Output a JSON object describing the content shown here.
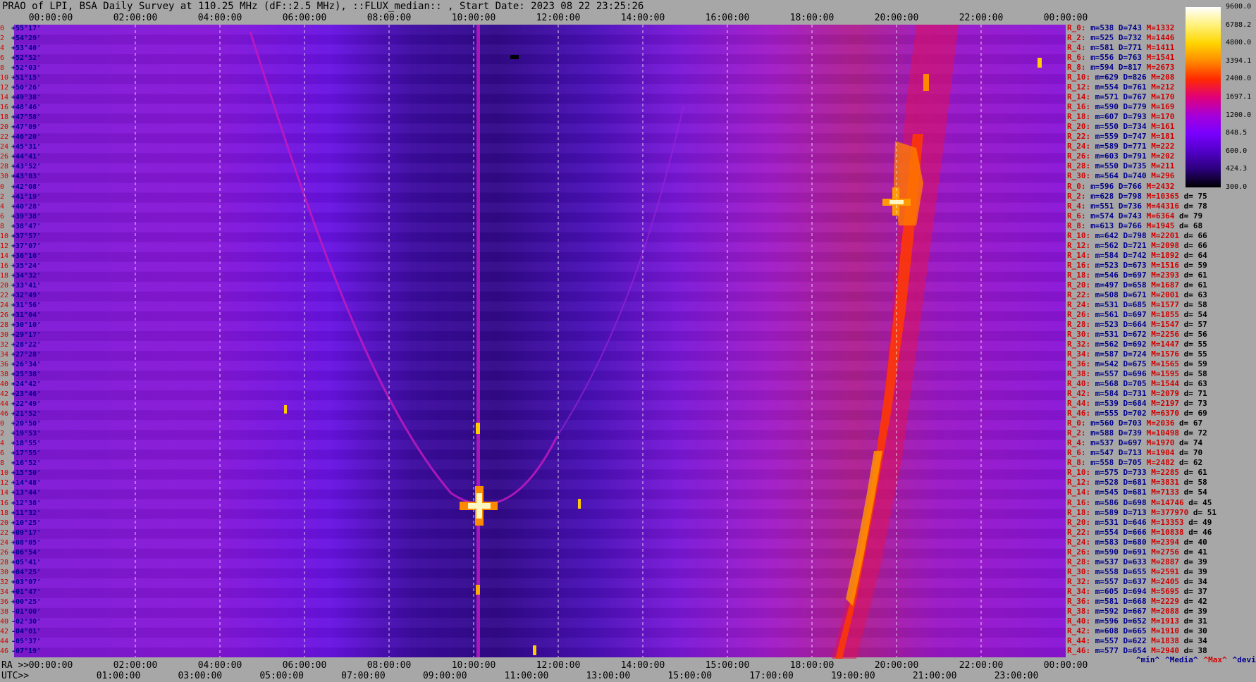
{
  "title": "PRAO of LPI, BSA Daily Survey at 110.25 MHz (dF::2.5 MHz), ::FLUX_median:: , Start Date: 2023 08 22 23:25:26",
  "chart_data": {
    "type": "heatmap",
    "title": "PRAO of LPI, BSA Daily Survey at 110.25 MHz (dF::2.5 MHz), ::FLUX_median:: , Start Date: 2023 08 22 23:25:26",
    "x_top_ticks": [
      "00:00:00",
      "02:00:00",
      "04:00:00",
      "06:00:00",
      "08:00:00",
      "10:00:00",
      "12:00:00",
      "14:00:00",
      "16:00:00",
      "18:00:00",
      "20:00:00",
      "22:00:00",
      "00:00:00"
    ],
    "x_bottom_ra_label": "RA >>",
    "x_bottom_ra_ticks": [
      "00:00:00",
      "02:00:00",
      "04:00:00",
      "06:00:00",
      "08:00:00",
      "10:00:00",
      "12:00:00",
      "14:00:00",
      "15:00:00",
      "18:00:00",
      "20:00:00",
      "22:00:00",
      "00:00:00"
    ],
    "x_bottom_utc_label": "UTC>>",
    "x_bottom_utc_ticks": [
      "01:00:00",
      "03:00:00",
      "05:00:00",
      "07:00:00",
      "09:00:00",
      "11:00:00",
      "13:00:00",
      "15:00:00",
      "17:00:00",
      "19:00:00",
      "21:00:00",
      "23:00:00"
    ],
    "y_rows": [
      {
        "n": "0",
        "dec": "+55°17'"
      },
      {
        "n": "2",
        "dec": "+54°29'"
      },
      {
        "n": "4",
        "dec": "+53°40'"
      },
      {
        "n": "6",
        "dec": "+52°52'"
      },
      {
        "n": "8",
        "dec": "+52°03'"
      },
      {
        "n": "10",
        "dec": "+51°15'"
      },
      {
        "n": "12",
        "dec": "+50°26'"
      },
      {
        "n": "14",
        "dec": "+49°38'"
      },
      {
        "n": "16",
        "dec": "+48°46'"
      },
      {
        "n": "18",
        "dec": "+47°58'"
      },
      {
        "n": "20",
        "dec": "+47°09'"
      },
      {
        "n": "22",
        "dec": "+46°20'"
      },
      {
        "n": "24",
        "dec": "+45°31'"
      },
      {
        "n": "26",
        "dec": "+44°41'"
      },
      {
        "n": "28",
        "dec": "+43°52'"
      },
      {
        "n": "30",
        "dec": "+43°03'"
      },
      {
        "n": "0",
        "dec": "+42°08'"
      },
      {
        "n": "2",
        "dec": "+41°19'"
      },
      {
        "n": "4",
        "dec": "+40°28'"
      },
      {
        "n": "6",
        "dec": "+39°38'"
      },
      {
        "n": "8",
        "dec": "+38°47'"
      },
      {
        "n": "10",
        "dec": "+37°57'"
      },
      {
        "n": "12",
        "dec": "+37°07'"
      },
      {
        "n": "14",
        "dec": "+36°16'"
      },
      {
        "n": "16",
        "dec": "+35°24'"
      },
      {
        "n": "18",
        "dec": "+34°32'"
      },
      {
        "n": "20",
        "dec": "+33°41'"
      },
      {
        "n": "22",
        "dec": "+32°49'"
      },
      {
        "n": "24",
        "dec": "+31°56'"
      },
      {
        "n": "26",
        "dec": "+31°04'"
      },
      {
        "n": "28",
        "dec": "+30°10'"
      },
      {
        "n": "30",
        "dec": "+29°17'"
      },
      {
        "n": "32",
        "dec": "+28°22'"
      },
      {
        "n": "34",
        "dec": "+27°28'"
      },
      {
        "n": "36",
        "dec": "+26°34'"
      },
      {
        "n": "38",
        "dec": "+25°38'"
      },
      {
        "n": "40",
        "dec": "+24°42'"
      },
      {
        "n": "42",
        "dec": "+23°46'"
      },
      {
        "n": "44",
        "dec": "+22°49'"
      },
      {
        "n": "46",
        "dec": "+21°52'"
      },
      {
        "n": "0",
        "dec": "+20°50'"
      },
      {
        "n": "2",
        "dec": "+19°53'"
      },
      {
        "n": "4",
        "dec": "+18°55'"
      },
      {
        "n": "6",
        "dec": "+17°55'"
      },
      {
        "n": "8",
        "dec": "+16°52'"
      },
      {
        "n": "10",
        "dec": "+15°50'"
      },
      {
        "n": "12",
        "dec": "+14°48'"
      },
      {
        "n": "14",
        "dec": "+13°44'"
      },
      {
        "n": "16",
        "dec": "+12°38'"
      },
      {
        "n": "18",
        "dec": "+11°32'"
      },
      {
        "n": "20",
        "dec": "+10°25'"
      },
      {
        "n": "22",
        "dec": "+09°17'"
      },
      {
        "n": "24",
        "dec": "+08°05'"
      },
      {
        "n": "26",
        "dec": "+06°54'"
      },
      {
        "n": "28",
        "dec": "+05°41'"
      },
      {
        "n": "30",
        "dec": "+04°25'"
      },
      {
        "n": "32",
        "dec": "+03°07'"
      },
      {
        "n": "34",
        "dec": "+01°47'"
      },
      {
        "n": "36",
        "dec": "+00°25'"
      },
      {
        "n": "38",
        "dec": "-01°00'"
      },
      {
        "n": "40",
        "dec": "-02°30'"
      },
      {
        "n": "42",
        "dec": "-04°01'"
      },
      {
        "n": "44",
        "dec": "-05°37'"
      },
      {
        "n": "46",
        "dec": "-07°19'"
      }
    ],
    "colorbar": {
      "ticks": [
        "9600.0",
        "6788.2",
        "4800.0",
        "3394.1",
        "2400.0",
        "1697.1",
        "1200.0",
        "848.5",
        "600.0",
        "424.3",
        "300.0"
      ],
      "colors": [
        "#ffffff",
        "#fff27a",
        "#ffd500",
        "#ff8a00",
        "#ff2a00",
        "#e0007a",
        "#a600d8",
        "#7a00ff",
        "#5200c8",
        "#2a007a",
        "#000000"
      ]
    },
    "stats": [
      {
        "r": "R_0:",
        "m": "m=538",
        "d": "D=743",
        "x": "M=1332",
        "dv": ""
      },
      {
        "r": "R_2:",
        "m": "m=525",
        "d": "D=732",
        "x": "M=1446",
        "dv": ""
      },
      {
        "r": "R_4:",
        "m": "m=581",
        "d": "D=771",
        "x": "M=1411",
        "dv": ""
      },
      {
        "r": "R_6:",
        "m": "m=556",
        "d": "D=763",
        "x": "M=1541",
        "dv": ""
      },
      {
        "r": "R_8:",
        "m": "m=594",
        "d": "D=817",
        "x": "M=2673",
        "dv": ""
      },
      {
        "r": "R_10:",
        "m": "m=629",
        "d": "D=826",
        "x": "M=208",
        "dv": ""
      },
      {
        "r": "R_12:",
        "m": "m=554",
        "d": "D=761",
        "x": "M=212",
        "dv": ""
      },
      {
        "r": "R_14:",
        "m": "m=571",
        "d": "D=767",
        "x": "M=170",
        "dv": ""
      },
      {
        "r": "R_16:",
        "m": "m=590",
        "d": "D=779",
        "x": "M=169",
        "dv": ""
      },
      {
        "r": "R_18:",
        "m": "m=607",
        "d": "D=793",
        "x": "M=170",
        "dv": ""
      },
      {
        "r": "R_20:",
        "m": "m=550",
        "d": "D=734",
        "x": "M=161",
        "dv": ""
      },
      {
        "r": "R_22:",
        "m": "m=559",
        "d": "D=747",
        "x": "M=181",
        "dv": ""
      },
      {
        "r": "R_24:",
        "m": "m=589",
        "d": "D=771",
        "x": "M=222",
        "dv": ""
      },
      {
        "r": "R_26:",
        "m": "m=603",
        "d": "D=791",
        "x": "M=202",
        "dv": ""
      },
      {
        "r": "R_28:",
        "m": "m=550",
        "d": "D=735",
        "x": "M=211",
        "dv": ""
      },
      {
        "r": "R_30:",
        "m": "m=564",
        "d": "D=740",
        "x": "M=296",
        "dv": ""
      },
      {
        "r": "R_0:",
        "m": "m=596",
        "d": "D=766",
        "x": "M=2432",
        "dv": ""
      },
      {
        "r": "R_2:",
        "m": "m=628",
        "d": "D=798",
        "x": "M=10365",
        "dv": "d= 75"
      },
      {
        "r": "R_4:",
        "m": "m=551",
        "d": "D=736",
        "x": "M=44316",
        "dv": "d= 78"
      },
      {
        "r": "R_6:",
        "m": "m=574",
        "d": "D=743",
        "x": "M=6364",
        "dv": "d= 79"
      },
      {
        "r": "R_8:",
        "m": "m=613",
        "d": "D=766",
        "x": "M=1945",
        "dv": "d= 68"
      },
      {
        "r": "R_10:",
        "m": "m=642",
        "d": "D=798",
        "x": "M=2201",
        "dv": "d= 66"
      },
      {
        "r": "R_12:",
        "m": "m=562",
        "d": "D=721",
        "x": "M=2098",
        "dv": "d= 66"
      },
      {
        "r": "R_14:",
        "m": "m=584",
        "d": "D=742",
        "x": "M=1892",
        "dv": "d= 64"
      },
      {
        "r": "R_16:",
        "m": "m=523",
        "d": "D=673",
        "x": "M=1516",
        "dv": "d= 59"
      },
      {
        "r": "R_18:",
        "m": "m=546",
        "d": "D=697",
        "x": "M=2393",
        "dv": "d= 61"
      },
      {
        "r": "R_20:",
        "m": "m=497",
        "d": "D=658",
        "x": "M=1687",
        "dv": "d= 61"
      },
      {
        "r": "R_22:",
        "m": "m=508",
        "d": "D=671",
        "x": "M=2001",
        "dv": "d= 63"
      },
      {
        "r": "R_24:",
        "m": "m=531",
        "d": "D=685",
        "x": "M=1577",
        "dv": "d= 58"
      },
      {
        "r": "R_26:",
        "m": "m=561",
        "d": "D=697",
        "x": "M=1855",
        "dv": "d= 54"
      },
      {
        "r": "R_28:",
        "m": "m=523",
        "d": "D=664",
        "x": "M=1547",
        "dv": "d= 57"
      },
      {
        "r": "R_30:",
        "m": "m=531",
        "d": "D=672",
        "x": "M=2256",
        "dv": "d= 56"
      },
      {
        "r": "R_32:",
        "m": "m=562",
        "d": "D=692",
        "x": "M=1447",
        "dv": "d= 55"
      },
      {
        "r": "R_34:",
        "m": "m=587",
        "d": "D=724",
        "x": "M=1576",
        "dv": "d= 55"
      },
      {
        "r": "R_36:",
        "m": "m=542",
        "d": "D=675",
        "x": "M=1565",
        "dv": "d= 59"
      },
      {
        "r": "R_38:",
        "m": "m=557",
        "d": "D=696",
        "x": "M=1595",
        "dv": "d= 58"
      },
      {
        "r": "R_40:",
        "m": "m=568",
        "d": "D=705",
        "x": "M=1544",
        "dv": "d= 63"
      },
      {
        "r": "R_42:",
        "m": "m=584",
        "d": "D=731",
        "x": "M=2079",
        "dv": "d= 71"
      },
      {
        "r": "R_44:",
        "m": "m=539",
        "d": "D=684",
        "x": "M=2197",
        "dv": "d= 73"
      },
      {
        "r": "R_46:",
        "m": "m=555",
        "d": "D=702",
        "x": "M=6370",
        "dv": "d= 69"
      },
      {
        "r": "R_0:",
        "m": "m=560",
        "d": "D=703",
        "x": "M=2036",
        "dv": "d= 67"
      },
      {
        "r": "R_2:",
        "m": "m=588",
        "d": "D=739",
        "x": "M=10498",
        "dv": "d= 72"
      },
      {
        "r": "R_4:",
        "m": "m=537",
        "d": "D=697",
        "x": "M=1970",
        "dv": "d= 74"
      },
      {
        "r": "R_6:",
        "m": "m=547",
        "d": "D=713",
        "x": "M=1904",
        "dv": "d= 70"
      },
      {
        "r": "R_8:",
        "m": "m=558",
        "d": "D=705",
        "x": "M=2482",
        "dv": "d= 62"
      },
      {
        "r": "R_10:",
        "m": "m=575",
        "d": "D=733",
        "x": "M=2285",
        "dv": "d= 61"
      },
      {
        "r": "R_12:",
        "m": "m=528",
        "d": "D=681",
        "x": "M=3831",
        "dv": "d= 58"
      },
      {
        "r": "R_14:",
        "m": "m=545",
        "d": "D=681",
        "x": "M=7133",
        "dv": "d= 54"
      },
      {
        "r": "R_16:",
        "m": "m=586",
        "d": "D=698",
        "x": "M=14746",
        "dv": "d= 45"
      },
      {
        "r": "R_18:",
        "m": "m=589",
        "d": "D=713",
        "x": "M=377970",
        "dv": "d= 51"
      },
      {
        "r": "R_20:",
        "m": "m=531",
        "d": "D=646",
        "x": "M=13353",
        "dv": "d= 49"
      },
      {
        "r": "R_22:",
        "m": "m=554",
        "d": "D=666",
        "x": "M=10838",
        "dv": "d= 46"
      },
      {
        "r": "R_24:",
        "m": "m=583",
        "d": "D=680",
        "x": "M=2394",
        "dv": "d= 40"
      },
      {
        "r": "R_26:",
        "m": "m=590",
        "d": "D=691",
        "x": "M=2756",
        "dv": "d= 41"
      },
      {
        "r": "R_28:",
        "m": "m=537",
        "d": "D=633",
        "x": "M=2887",
        "dv": "d= 39"
      },
      {
        "r": "R_30:",
        "m": "m=558",
        "d": "D=655",
        "x": "M=2591",
        "dv": "d= 39"
      },
      {
        "r": "R_32:",
        "m": "m=557",
        "d": "D=637",
        "x": "M=2405",
        "dv": "d= 34"
      },
      {
        "r": "R_34:",
        "m": "m=605",
        "d": "D=694",
        "x": "M=5695",
        "dv": "d= 37"
      },
      {
        "r": "R_36:",
        "m": "m=581",
        "d": "D=668",
        "x": "M=2229",
        "dv": "d= 42"
      },
      {
        "r": "R_38:",
        "m": "m=592",
        "d": "D=667",
        "x": "M=2088",
        "dv": "d= 39"
      },
      {
        "r": "R_40:",
        "m": "m=596",
        "d": "D=652",
        "x": "M=1913",
        "dv": "d= 31"
      },
      {
        "r": "R_42:",
        "m": "m=608",
        "d": "D=665",
        "x": "M=1910",
        "dv": "d= 30"
      },
      {
        "r": "R_44:",
        "m": "m=557",
        "d": "D=622",
        "x": "M=1838",
        "dv": "d= 34"
      },
      {
        "r": "R_46:",
        "m": "m=577",
        "d": "D=654",
        "x": "M=2940",
        "dv": "d= 38"
      }
    ],
    "legend": [
      "^min^",
      "^Media^",
      "^Max^",
      "^devia^"
    ],
    "grid": "on"
  }
}
